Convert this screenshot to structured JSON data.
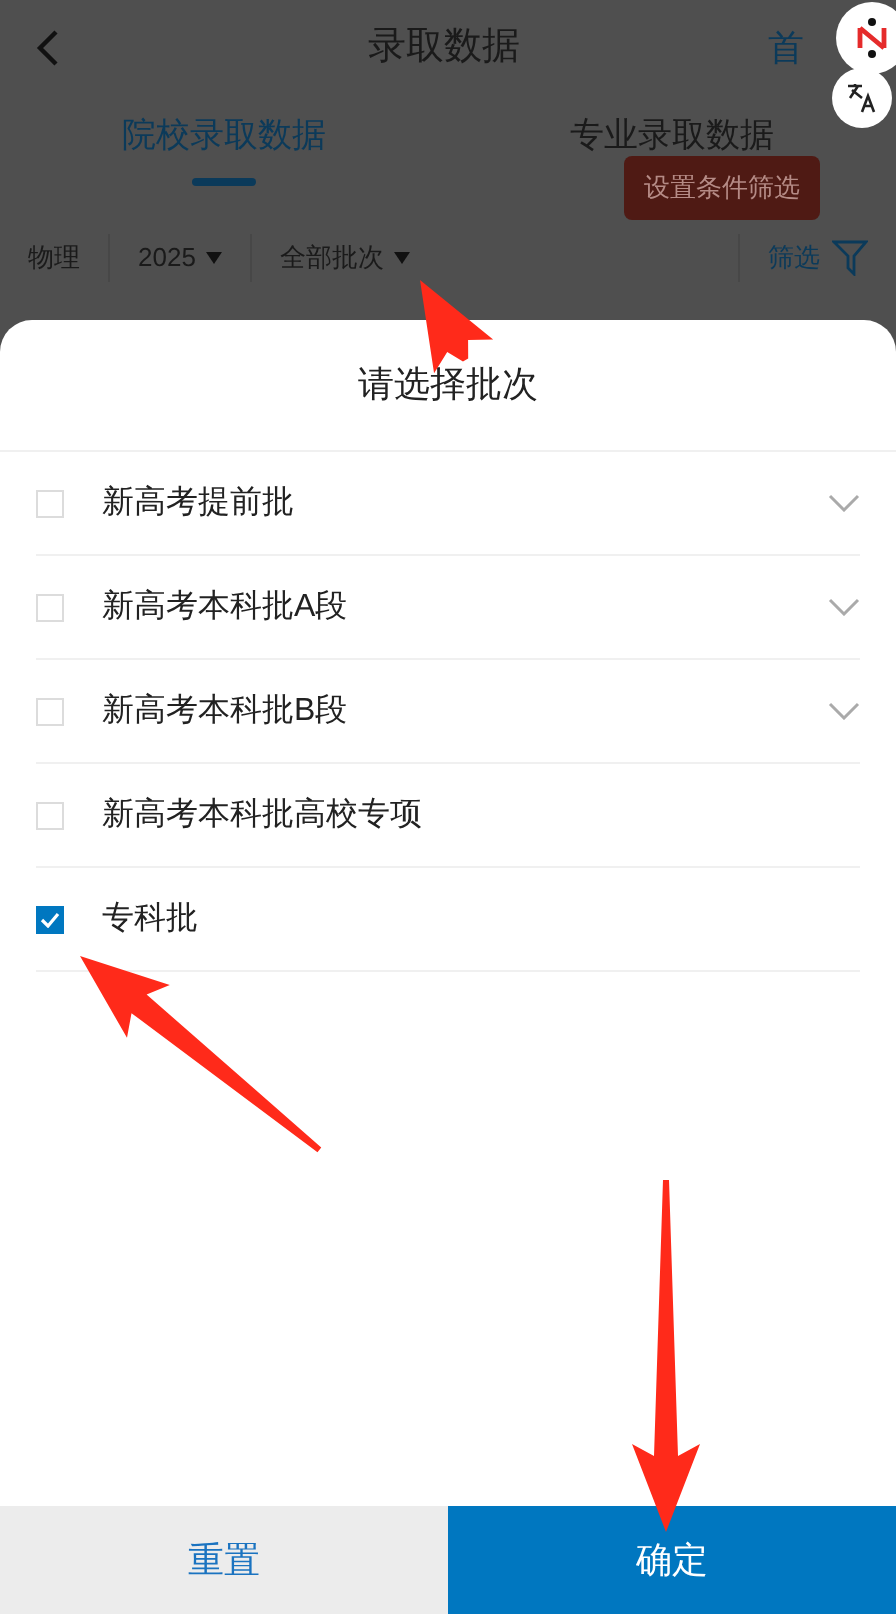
{
  "header": {
    "title": "录取数据",
    "home_link": "首"
  },
  "tabs": [
    {
      "label": "院校录取数据",
      "selected": true
    },
    {
      "label": "专业录取数据",
      "selected": false
    }
  ],
  "tooltip": "设置条件筛选",
  "filters": [
    {
      "label": "物理",
      "dropdown": false
    },
    {
      "label": "2025",
      "dropdown": true
    },
    {
      "label": "全部批次",
      "dropdown": true
    }
  ],
  "filter_button": "筛选",
  "sheet": {
    "title": "请选择批次",
    "options": [
      {
        "label": "新高考提前批",
        "checked": false,
        "expandable": true
      },
      {
        "label": "新高考本科批A段",
        "checked": false,
        "expandable": true
      },
      {
        "label": "新高考本科批B段",
        "checked": false,
        "expandable": true
      },
      {
        "label": "新高考本科批高校专项",
        "checked": false,
        "expandable": false
      },
      {
        "label": "专科批",
        "checked": true,
        "expandable": false
      }
    ],
    "buttons": [
      {
        "label": "重置",
        "kind": "secondary"
      },
      {
        "label": "确定",
        "kind": "primary"
      }
    ]
  }
}
